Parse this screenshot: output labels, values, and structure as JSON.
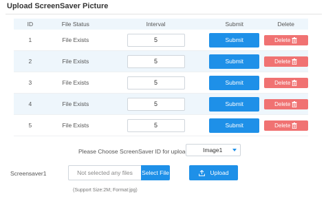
{
  "title": "Upload ScreenSaver Picture",
  "table": {
    "headers": {
      "id": "ID",
      "status": "File Status",
      "interval": "Interval",
      "submit": "Submit",
      "delete": "Delete"
    },
    "rows": [
      {
        "id": "1",
        "status": "File Exists",
        "interval": "5",
        "submit": "Submit",
        "delete": "Delete"
      },
      {
        "id": "2",
        "status": "File Exists",
        "interval": "5",
        "submit": "Submit",
        "delete": "Delete"
      },
      {
        "id": "3",
        "status": "File Exists",
        "interval": "5",
        "submit": "Submit",
        "delete": "Delete"
      },
      {
        "id": "4",
        "status": "File Exists",
        "interval": "5",
        "submit": "Submit",
        "delete": "Delete"
      },
      {
        "id": "5",
        "status": "File Exists",
        "interval": "5",
        "submit": "Submit",
        "delete": "Delete"
      }
    ]
  },
  "choose": {
    "label": "Please Choose ScreenSaver ID for upload",
    "selected": "Image1"
  },
  "upload_section": {
    "label": "Screensaver1",
    "file_placeholder": "Not selected any files",
    "select_file": "Select File",
    "upload": "Upload",
    "note": "(Support Size:2M; Format:jpg)"
  },
  "colors": {
    "primary": "#1e90e8",
    "danger": "#f07272",
    "row_alt": "#eef6fc"
  }
}
